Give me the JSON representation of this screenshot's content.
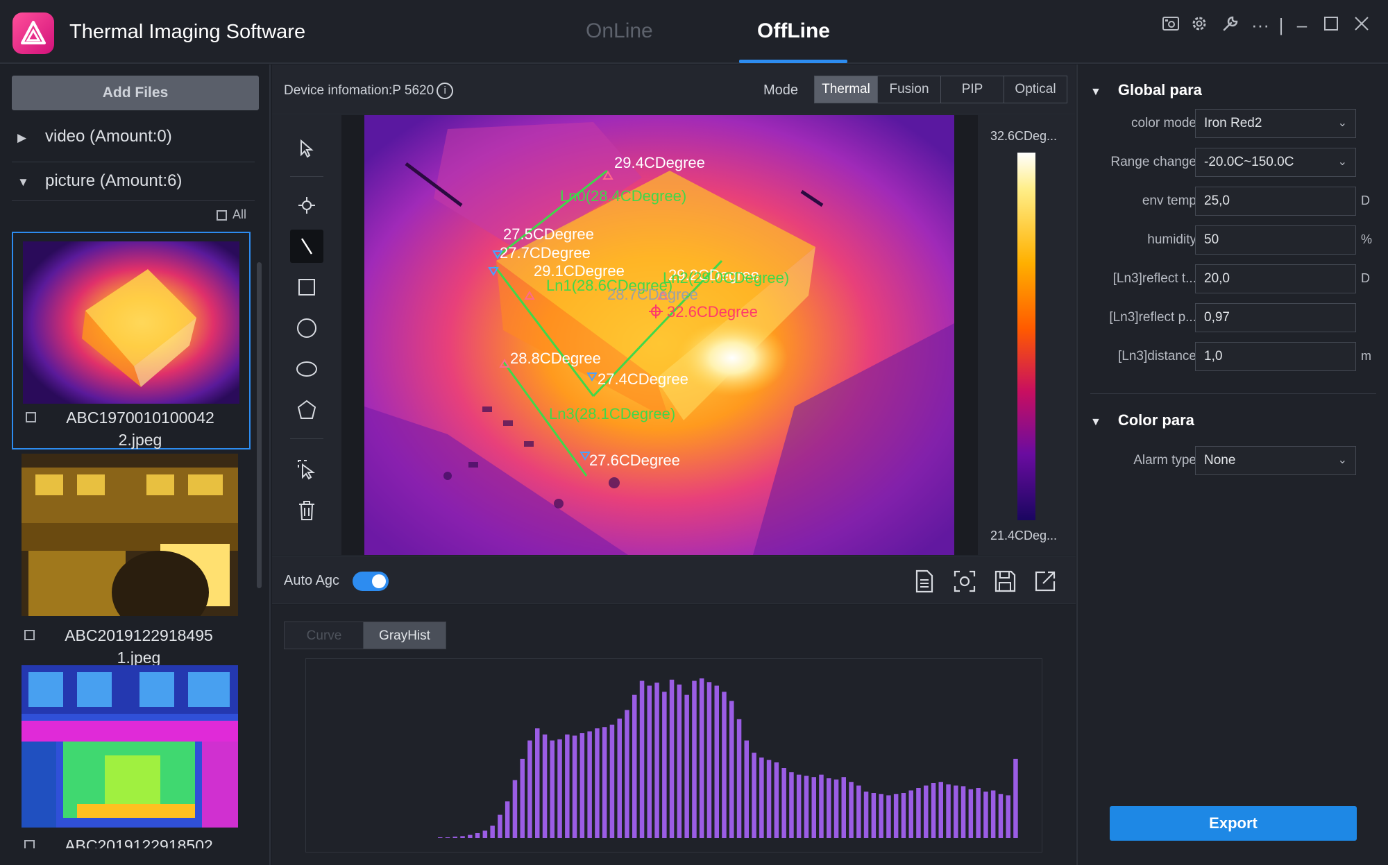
{
  "app": {
    "title": "Thermal Imaging Software"
  },
  "modes": {
    "online": "OnLine",
    "offline": "OffLine"
  },
  "left": {
    "add_files": "Add Files",
    "video_group": "video (Amount:0)",
    "picture_group": "picture (Amount:6)",
    "all_label": "All",
    "files": [
      {
        "name": "ABC1970010100042\n2.jpeg"
      },
      {
        "name": "ABC2019122918495\n1.jpeg"
      },
      {
        "name": "ABC2019122918502"
      }
    ]
  },
  "viewer": {
    "device_info": "Device infomation:P 5620",
    "mode_label": "Mode",
    "tabs": [
      "Thermal",
      "Fusion",
      "PIP",
      "Optical"
    ],
    "active_tab": "Thermal",
    "scale_max": "32.6CDeg...",
    "scale_min": "21.4CDeg...",
    "annotations": {
      "t1": "29.4CDegree",
      "ln0": "Ln0(28.4CDegree)",
      "t2": "27.5CDegree",
      "t3": "27.7CDegree",
      "t4": "29.1CDegree",
      "ln1": "Ln1(28.6CDegree)",
      "ln2": "Ln2(29.0CDegree)",
      "t5": "29.2CDegree",
      "t6": "28.7CDegree",
      "t7": "32.6CDegree",
      "t8": "28.8CDegree",
      "t9": "27.4CDegree",
      "ln3": "Ln3(28.1CDegree)",
      "t10": "27.6CDegree"
    }
  },
  "agc": {
    "label": "Auto Agc",
    "enabled": true
  },
  "histogram": {
    "tabs": {
      "curve": "Curve",
      "grayhist": "GrayHist"
    },
    "active_tab": "GrayHist",
    "bar_color": "#9b5de5",
    "values": [
      1,
      1,
      2,
      3,
      5,
      8,
      12,
      20,
      38,
      60,
      95,
      130,
      160,
      180,
      170,
      160,
      162,
      170,
      168,
      172,
      175,
      180,
      182,
      186,
      196,
      210,
      235,
      258,
      250,
      255,
      240,
      260,
      252,
      235,
      258,
      262,
      256,
      250,
      240,
      225,
      195,
      160,
      140,
      132,
      128,
      124,
      115,
      108,
      104,
      102,
      100,
      104,
      98,
      96,
      100,
      92,
      86,
      76,
      74,
      72,
      70,
      72,
      74,
      78,
      82,
      86,
      90,
      92,
      88,
      86,
      85,
      80,
      82,
      76,
      78,
      72,
      70,
      130
    ]
  },
  "right": {
    "global_title": "Global para",
    "params": [
      {
        "label": "color mode",
        "value": "Iron Red2",
        "type": "select",
        "unit": ""
      },
      {
        "label": "Range change",
        "value": "-20.0C~150.0C",
        "type": "select",
        "unit": ""
      },
      {
        "label": "env temp",
        "value": "25,0",
        "type": "input",
        "unit": "D"
      },
      {
        "label": "humidity",
        "value": "50",
        "type": "input",
        "unit": "%"
      },
      {
        "label": "[Ln3]reflect t...",
        "value": "20,0",
        "type": "input",
        "unit": "D"
      },
      {
        "label": "[Ln3]reflect p...",
        "value": "0,97",
        "type": "input",
        "unit": ""
      },
      {
        "label": "[Ln3]distance",
        "value": "1,0",
        "type": "input",
        "unit": "m"
      }
    ],
    "color_title": "Color para",
    "alarm_label": "Alarm type",
    "alarm_value": "None",
    "export": "Export"
  },
  "colors": {
    "accent": "#2d8cf0",
    "export": "#1e88e5",
    "line": "#3fd84a"
  }
}
